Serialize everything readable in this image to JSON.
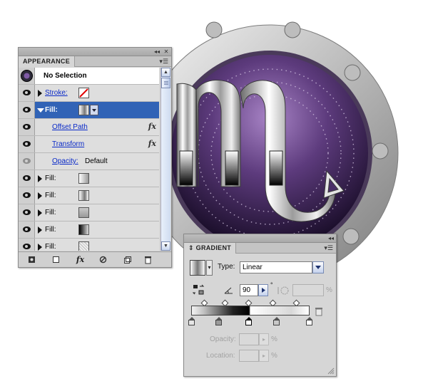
{
  "colors": {
    "selection": "#3163b6",
    "link": "#0a2ac8",
    "panel_bg": "#d6d6d6",
    "artwork_purple": "#3f2757"
  },
  "appearance": {
    "tab_label": "APPEARANCE",
    "menu_icon": "panel-menu-icon",
    "header_label": "No Selection",
    "rows": [
      {
        "id": "stroke",
        "label": "Stroke:",
        "link": true,
        "expanded": false,
        "swatch": "none-stroke"
      },
      {
        "id": "fill-main",
        "label": "Fill:",
        "selected": true,
        "expanded": true,
        "swatch": "gradient"
      },
      {
        "id": "offset-path",
        "label": "Offset Path",
        "link": true,
        "fx": "fx"
      },
      {
        "id": "transform",
        "label": "Transform",
        "link": true,
        "fx": "fx"
      },
      {
        "id": "opacity",
        "label": "Opacity:",
        "value": "Default",
        "link": true
      },
      {
        "id": "fill-2",
        "label": "Fill:",
        "swatch": "gradient-light"
      },
      {
        "id": "fill-3",
        "label": "Fill:",
        "swatch": "gradient-gray"
      },
      {
        "id": "fill-4",
        "label": "Fill:",
        "swatch": "gray"
      },
      {
        "id": "fill-5",
        "label": "Fill:",
        "swatch": "black-gradient"
      },
      {
        "id": "fill-6",
        "label": "Fill:",
        "swatch": "pattern"
      }
    ],
    "footer_icons": [
      "new-art-icon",
      "clear-appearance-icon",
      "fx-menu-icon",
      "reduce-basic-icon",
      "duplicate-icon",
      "trash-icon"
    ]
  },
  "gradient": {
    "tab_label": "GRADIENT",
    "type_label": "Type:",
    "type_value": "Linear",
    "angle_value": "90",
    "angle_unit": "°",
    "percent_unit": "%",
    "opacity_label": "Opacity:",
    "location_label": "Location:",
    "stops_count": 5
  }
}
